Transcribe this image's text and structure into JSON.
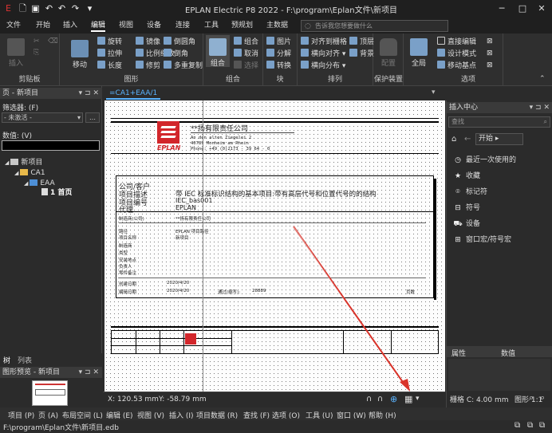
{
  "titlebar": {
    "title": "EPLAN Electric P8 2022 - F:\\program\\Eplan文件\\新项目",
    "minimize": "─",
    "maximize": "□",
    "close": "✕"
  },
  "menutabs": [
    "文件",
    "开始",
    "插入",
    "编辑",
    "视图",
    "设备",
    "连接",
    "工具",
    "预规划",
    "主数据"
  ],
  "menutab_active": "编辑",
  "search_placeholder": "告诉我您想要做什么",
  "ribbon": {
    "g1": {
      "label": "剪贴板",
      "big": "插入"
    },
    "g2": {
      "label": "图形",
      "big": "移动",
      "items": [
        "旋转",
        "镜像",
        "倒圆角",
        "拉伸",
        "比例缩放",
        "倒角",
        "长度",
        "修剪",
        "多重复制"
      ]
    },
    "g3": {
      "label": "组合",
      "big": "组合",
      "items": [
        "组合",
        "取消",
        "选择"
      ]
    },
    "g4": {
      "label": "块",
      "items": [
        "图片",
        "分解",
        "转换"
      ]
    },
    "g5": {
      "label": "排列",
      "items": [
        "对齐到栅格",
        "顶层",
        "横向对齐",
        "背景",
        "横向分布"
      ]
    },
    "g6": {
      "label": "保护装置",
      "big": "配置"
    },
    "g7": {
      "label": "",
      "big": "全局"
    },
    "g8": {
      "label": "选项",
      "items": [
        "直接编辑",
        "设计模式",
        "移动基点"
      ]
    }
  },
  "leftpanel": {
    "header": "页 - 新项目",
    "filter_label": "筛选器: (F)",
    "filter_value": "- 未激活 -",
    "value_label": "数值: (V)",
    "tree": [
      {
        "label": "新项目"
      },
      {
        "label": "CA1"
      },
      {
        "label": "EAA"
      },
      {
        "label": "1 首页"
      }
    ],
    "tabs": [
      "树",
      "列表"
    ],
    "preview_header": "图形预览 - 新项目"
  },
  "doc_tab": "=CA1+EAA/1",
  "drawing": {
    "company_title": "**扬有限责任公司",
    "address1": "An den alten Ziegelei 2",
    "address2": "40789    Monheim am Rhein",
    "address3": "Phone: +49 (0)2173 - 39 64 - 0",
    "logo_text": "EPLAN",
    "company_client_label": "公司/客户",
    "project_desc_label": "项目描述",
    "project_desc_value": "带 IEC 标准标识结构的基本项目:带有高层代号和位置代号的的结构",
    "project_no_label": "项目编号",
    "project_no_value": "IEC_bas001",
    "agent_label": "代理",
    "agent_value": "EPLAN",
    "row_labels": [
      "制造商(公司)",
      "路径",
      "项目名称",
      "制造商",
      "类型",
      "安装地点",
      "负责人",
      "零件备注",
      "创建日期",
      "编辑日期"
    ],
    "manufacturer_value": "**扬有限责任公司",
    "path_value": "EPLAN 项目路径",
    "project_name_value": "新项目",
    "created_date": "2020/4/20",
    "edited_date": "2020/4/20",
    "by_label": "通过(缩写):",
    "by_value": "28889",
    "pages_label": "页数"
  },
  "coords": {
    "x": "X: 120.53 mm",
    "y": "Y: -58.79 mm",
    "grid": "栅格 C: 4.00 mm",
    "scale": "图形 1:1"
  },
  "rightpanel": {
    "header": "插入中心",
    "search_placeholder": "查找",
    "crumb": "开始",
    "items": [
      "最近一次使用的",
      "收藏",
      "标记符",
      "符号",
      "设备",
      "窗口宏/符号宏"
    ],
    "props_label": "属性",
    "props_value": "数值"
  },
  "bottom_menu": [
    "项目 (P)",
    "页 (A)",
    "布局空间 (L)",
    "编辑 (E)",
    "视图 (V)",
    "插入 (I)",
    "项目数据 (R)",
    "查找 (F)",
    "选项 (O)",
    "工具 (U)",
    "窗口 (W)",
    "帮助 (H)"
  ],
  "status_path": "F:\\program\\Eplan文件\\新项目.edb",
  "colors": {
    "accent": "#5ab4ff",
    "arrow": "#d9342b",
    "logo": "#d2262b"
  }
}
